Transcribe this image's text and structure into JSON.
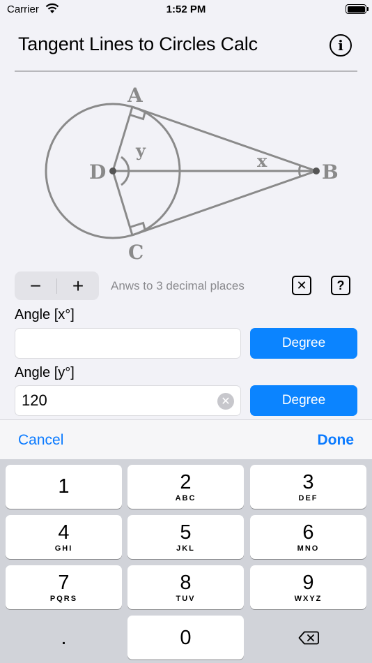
{
  "status_bar": {
    "carrier": "Carrier",
    "time": "1:52 PM"
  },
  "header": {
    "title": "Tangent Lines to Circles Calc",
    "info_glyph": "i"
  },
  "diagram": {
    "labels": {
      "a": "A",
      "b": "B",
      "c": "C",
      "d": "D",
      "x": "x",
      "y": "y"
    },
    "stroke_color": "#8a8a8a"
  },
  "controls": {
    "minus": "−",
    "plus": "+",
    "decimals_text": "Anws to 3 decimal places",
    "clear_glyph": "✕",
    "help_glyph": "?"
  },
  "fields": [
    {
      "label": "Angle [x°]",
      "value": "",
      "button": "Degree"
    },
    {
      "label": "Angle [y°]",
      "value": "120",
      "button": "Degree"
    }
  ],
  "keyboard_toolbar": {
    "cancel": "Cancel",
    "done": "Done"
  },
  "keypad": {
    "keys": [
      {
        "num": "1",
        "letters": ""
      },
      {
        "num": "2",
        "letters": "ABC"
      },
      {
        "num": "3",
        "letters": "DEF"
      },
      {
        "num": "4",
        "letters": "GHI"
      },
      {
        "num": "5",
        "letters": "JKL"
      },
      {
        "num": "6",
        "letters": "MNO"
      },
      {
        "num": "7",
        "letters": "PQRS"
      },
      {
        "num": "8",
        "letters": "TUV"
      },
      {
        "num": "9",
        "letters": "WXYZ"
      },
      {
        "num": "0",
        "letters": ""
      }
    ],
    "decimal": ".",
    "accent": "#0a7aff"
  }
}
